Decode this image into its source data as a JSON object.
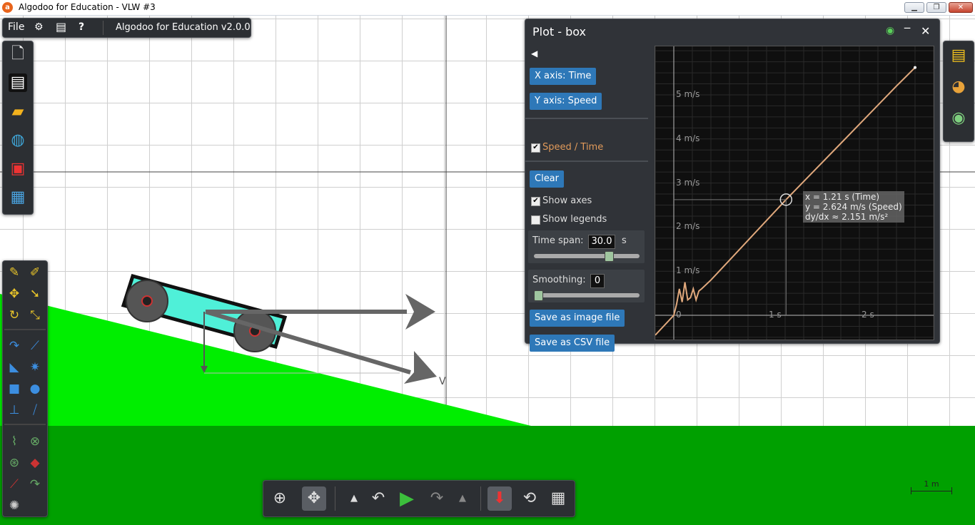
{
  "window": {
    "title": "Algodoo for Education - VLW #3",
    "app_icon": "algodoo-icon",
    "controls": [
      "minimize",
      "maximize",
      "close"
    ]
  },
  "top_menu": {
    "file_label": "File",
    "help_label": "?",
    "version": "Algodoo for Education v2.0.0",
    "icons": [
      "gear-icon",
      "window-icon",
      "help-icon"
    ]
  },
  "sidebar": {
    "icons": [
      "new-scene-icon",
      "save-icon",
      "open-folder-icon",
      "algobox-icon",
      "phunlet-icon",
      "lessons-icon"
    ]
  },
  "tools": {
    "icons": [
      "sketch-icon",
      "brush-icon",
      "move-icon",
      "drag-icon",
      "rotate-icon",
      "scale-icon",
      "rope-icon",
      "knife-icon",
      "polygon-icon",
      "gear-tool-icon",
      "box-icon",
      "circle-icon",
      "plane-icon",
      "chain-icon",
      "spring-icon",
      "fixate-icon",
      "hinge-icon",
      "thruster-icon",
      "laser-icon",
      "tracer-icon",
      "spiral-icon"
    ]
  },
  "right_bar": {
    "icons": [
      "background-icon",
      "palette-icon",
      "visualization-icon"
    ]
  },
  "bottom_bar": {
    "icons": [
      "zoom-icon",
      "pan-icon",
      "up-arrow-icon",
      "undo-icon",
      "play-icon",
      "redo-icon",
      "expand-icon",
      "gravity-icon",
      "air-friction-icon",
      "grid-icon"
    ]
  },
  "plot": {
    "title": "Plot - box",
    "x_axis_button": "X axis: Time",
    "y_axis_button": "Y axis: Speed",
    "series_label": "Speed / Time",
    "series_checked": true,
    "clear_button": "Clear",
    "show_axes_label": "Show axes",
    "show_axes_checked": true,
    "show_legends_label": "Show legends",
    "show_legends_checked": false,
    "time_span_label": "Time span:",
    "time_span_value": "30.0",
    "time_span_unit": "s",
    "time_span_fraction": 0.72,
    "smoothing_label": "Smoothing:",
    "smoothing_value": "0",
    "smoothing_fraction": 0.0,
    "save_image_button": "Save as image file",
    "save_csv_button": "Save as CSV file",
    "series_color": "#e0a87c",
    "tooltip": {
      "x_line": "x = 1.21 s (Time)",
      "y_line": "y = 2.624 m/s (Speed)",
      "slope_line": "dy/dx ≈ 2.151 m/s²"
    }
  },
  "chart_data": {
    "type": "line",
    "x_tick_labels": [
      "0",
      "1 s",
      "2 s"
    ],
    "y_tick_labels": [
      "1 m/s",
      "2 m/s",
      "3 m/s",
      "4 m/s",
      "5 m/s"
    ],
    "xlim": [
      -0.2,
      2.8
    ],
    "ylim": [
      -0.55,
      6.1
    ],
    "grid": true,
    "series": [
      {
        "x": [
          -0.2,
          0.0,
          0.03,
          0.06,
          0.09,
          0.12,
          0.15,
          0.18,
          0.21,
          0.24,
          0.27,
          0.3,
          0.4,
          0.6,
          0.8,
          1.0,
          1.21,
          1.5,
          1.8,
          2.1,
          2.4,
          2.6
        ],
        "y": [
          -0.45,
          0.0,
          0.25,
          0.6,
          0.3,
          0.75,
          0.35,
          0.4,
          0.6,
          0.35,
          0.55,
          0.6,
          0.8,
          1.25,
          1.7,
          2.15,
          2.624,
          3.25,
          3.9,
          4.55,
          5.2,
          5.62
        ]
      }
    ],
    "cursor": {
      "x": 1.21,
      "y": 2.624
    }
  },
  "scene": {
    "vector_label": "V",
    "scale_label": "1 m",
    "ground_color": "#00a000",
    "ramp_color": "#00ee00",
    "car_body_color": "#4ff0d8"
  }
}
